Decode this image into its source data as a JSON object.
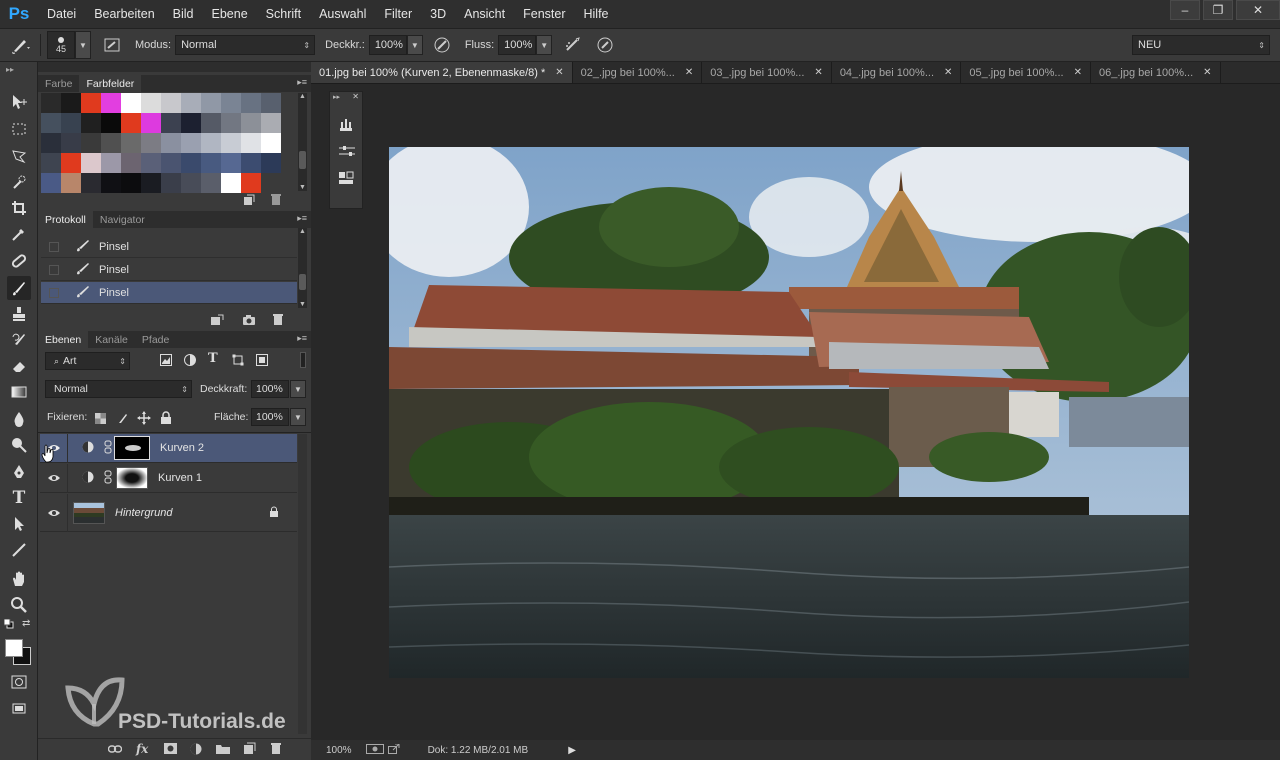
{
  "app": {
    "logo": "Ps",
    "menu": [
      "Datei",
      "Bearbeiten",
      "Bild",
      "Ebene",
      "Schrift",
      "Auswahl",
      "Filter",
      "3D",
      "Ansicht",
      "Fenster",
      "Hilfe"
    ],
    "window_controls": {
      "minimize": "–",
      "restore": "❐",
      "close": "✕"
    }
  },
  "options": {
    "brush_size": "45",
    "mode_label": "Modus:",
    "mode_value": "Normal",
    "opacity_label": "Deckkr.:",
    "opacity_value": "100%",
    "flow_label": "Fluss:",
    "flow_value": "100%",
    "workspace": "NEU"
  },
  "swatches": {
    "tabs": [
      "Farbe",
      "Farbfelder"
    ],
    "active_tab": "Farbfelder",
    "colors": [
      "#2a2a2a",
      "#1a1a1a",
      "#e03a1e",
      "#e23ee0",
      "#ffffff",
      "#dcdcdc",
      "#c8c8cc",
      "#a8adb8",
      "#9098a6",
      "#7a8494",
      "#687282",
      "#58606e",
      "#45505e",
      "#384250",
      "#202020",
      "#0a0a0a",
      "#e03a1e",
      "#dd3adf",
      "#3c4150",
      "#1c2030",
      "#555a66",
      "#727782",
      "#8c9098",
      "#aaacb2",
      "#2a2f3a",
      "#383c48",
      "#3a3a3a",
      "#505050",
      "#6a6a6a",
      "#7c7c84",
      "#8a90a0",
      "#9aa0b0",
      "#b0b6c2",
      "#c8ccd4",
      "#e0e2e6",
      "#ffffff",
      "#3e4450",
      "#e03a1e",
      "#dcc8cc",
      "#9c98a8",
      "#6c6470",
      "#5a6078",
      "#4a5470",
      "#3a4a6c",
      "#485a80",
      "#566892",
      "#3c4c70",
      "#2c3a58",
      "#4a5a86",
      "#b8866a",
      "#2a2a30",
      "#101014",
      "#0c0c0e",
      "#1a1c22",
      "#3a3e4a",
      "#484c58",
      "#5a5e6a",
      "#ffffff",
      "#e03a1e",
      "#3a3a3a"
    ]
  },
  "history": {
    "tabs": [
      "Protokoll",
      "Navigator"
    ],
    "items": [
      {
        "label": "Pinsel",
        "selected": false
      },
      {
        "label": "Pinsel",
        "selected": false
      },
      {
        "label": "Pinsel",
        "selected": true
      }
    ]
  },
  "layers": {
    "tabs": [
      "Ebenen",
      "Kanäle",
      "Pfade"
    ],
    "filter_kind": "Art",
    "blend_mode": "Normal",
    "opacity_label": "Deckkraft:",
    "opacity_value": "100%",
    "lock_label": "Fixieren:",
    "fill_label": "Fläche:",
    "fill_value": "100%",
    "items": [
      {
        "name": "Kurven 2",
        "selected": true
      },
      {
        "name": "Kurven 1",
        "selected": false
      },
      {
        "name": "Hintergrund",
        "selected": false
      }
    ]
  },
  "documents": {
    "tabs": [
      {
        "label": "01.jpg bei 100% (Kurven 2, Ebenenmaske/8) *",
        "active": true
      },
      {
        "label": "02_.jpg bei 100%...",
        "active": false
      },
      {
        "label": "03_.jpg bei 100%...",
        "active": false
      },
      {
        "label": "04_.jpg bei 100%...",
        "active": false
      },
      {
        "label": "05_.jpg bei 100%...",
        "active": false
      },
      {
        "label": "06_.jpg bei 100%...",
        "active": false
      }
    ],
    "close_glyph": "✕"
  },
  "status": {
    "zoom": "100%",
    "doc_info": "Dok: 1.22 MB/2.01 MB"
  },
  "watermark": "PSD-Tutorials.de"
}
